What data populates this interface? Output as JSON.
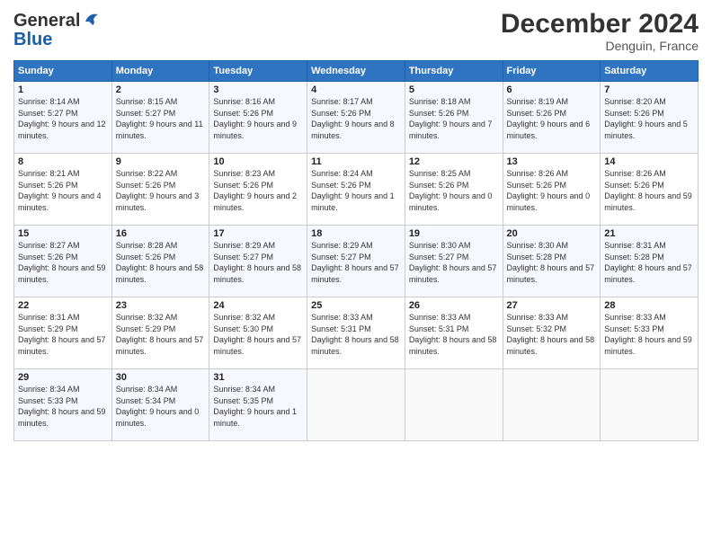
{
  "header": {
    "logo_general": "General",
    "logo_blue": "Blue",
    "month": "December 2024",
    "location": "Denguin, France"
  },
  "days_of_week": [
    "Sunday",
    "Monday",
    "Tuesday",
    "Wednesday",
    "Thursday",
    "Friday",
    "Saturday"
  ],
  "weeks": [
    [
      {
        "day": "1",
        "sunrise": "Sunrise: 8:14 AM",
        "sunset": "Sunset: 5:27 PM",
        "daylight": "Daylight: 9 hours and 12 minutes."
      },
      {
        "day": "2",
        "sunrise": "Sunrise: 8:15 AM",
        "sunset": "Sunset: 5:27 PM",
        "daylight": "Daylight: 9 hours and 11 minutes."
      },
      {
        "day": "3",
        "sunrise": "Sunrise: 8:16 AM",
        "sunset": "Sunset: 5:26 PM",
        "daylight": "Daylight: 9 hours and 9 minutes."
      },
      {
        "day": "4",
        "sunrise": "Sunrise: 8:17 AM",
        "sunset": "Sunset: 5:26 PM",
        "daylight": "Daylight: 9 hours and 8 minutes."
      },
      {
        "day": "5",
        "sunrise": "Sunrise: 8:18 AM",
        "sunset": "Sunset: 5:26 PM",
        "daylight": "Daylight: 9 hours and 7 minutes."
      },
      {
        "day": "6",
        "sunrise": "Sunrise: 8:19 AM",
        "sunset": "Sunset: 5:26 PM",
        "daylight": "Daylight: 9 hours and 6 minutes."
      },
      {
        "day": "7",
        "sunrise": "Sunrise: 8:20 AM",
        "sunset": "Sunset: 5:26 PM",
        "daylight": "Daylight: 9 hours and 5 minutes."
      }
    ],
    [
      {
        "day": "8",
        "sunrise": "Sunrise: 8:21 AM",
        "sunset": "Sunset: 5:26 PM",
        "daylight": "Daylight: 9 hours and 4 minutes."
      },
      {
        "day": "9",
        "sunrise": "Sunrise: 8:22 AM",
        "sunset": "Sunset: 5:26 PM",
        "daylight": "Daylight: 9 hours and 3 minutes."
      },
      {
        "day": "10",
        "sunrise": "Sunrise: 8:23 AM",
        "sunset": "Sunset: 5:26 PM",
        "daylight": "Daylight: 9 hours and 2 minutes."
      },
      {
        "day": "11",
        "sunrise": "Sunrise: 8:24 AM",
        "sunset": "Sunset: 5:26 PM",
        "daylight": "Daylight: 9 hours and 1 minute."
      },
      {
        "day": "12",
        "sunrise": "Sunrise: 8:25 AM",
        "sunset": "Sunset: 5:26 PM",
        "daylight": "Daylight: 9 hours and 0 minutes."
      },
      {
        "day": "13",
        "sunrise": "Sunrise: 8:26 AM",
        "sunset": "Sunset: 5:26 PM",
        "daylight": "Daylight: 9 hours and 0 minutes."
      },
      {
        "day": "14",
        "sunrise": "Sunrise: 8:26 AM",
        "sunset": "Sunset: 5:26 PM",
        "daylight": "Daylight: 8 hours and 59 minutes."
      }
    ],
    [
      {
        "day": "15",
        "sunrise": "Sunrise: 8:27 AM",
        "sunset": "Sunset: 5:26 PM",
        "daylight": "Daylight: 8 hours and 59 minutes."
      },
      {
        "day": "16",
        "sunrise": "Sunrise: 8:28 AM",
        "sunset": "Sunset: 5:26 PM",
        "daylight": "Daylight: 8 hours and 58 minutes."
      },
      {
        "day": "17",
        "sunrise": "Sunrise: 8:29 AM",
        "sunset": "Sunset: 5:27 PM",
        "daylight": "Daylight: 8 hours and 58 minutes."
      },
      {
        "day": "18",
        "sunrise": "Sunrise: 8:29 AM",
        "sunset": "Sunset: 5:27 PM",
        "daylight": "Daylight: 8 hours and 57 minutes."
      },
      {
        "day": "19",
        "sunrise": "Sunrise: 8:30 AM",
        "sunset": "Sunset: 5:27 PM",
        "daylight": "Daylight: 8 hours and 57 minutes."
      },
      {
        "day": "20",
        "sunrise": "Sunrise: 8:30 AM",
        "sunset": "Sunset: 5:28 PM",
        "daylight": "Daylight: 8 hours and 57 minutes."
      },
      {
        "day": "21",
        "sunrise": "Sunrise: 8:31 AM",
        "sunset": "Sunset: 5:28 PM",
        "daylight": "Daylight: 8 hours and 57 minutes."
      }
    ],
    [
      {
        "day": "22",
        "sunrise": "Sunrise: 8:31 AM",
        "sunset": "Sunset: 5:29 PM",
        "daylight": "Daylight: 8 hours and 57 minutes."
      },
      {
        "day": "23",
        "sunrise": "Sunrise: 8:32 AM",
        "sunset": "Sunset: 5:29 PM",
        "daylight": "Daylight: 8 hours and 57 minutes."
      },
      {
        "day": "24",
        "sunrise": "Sunrise: 8:32 AM",
        "sunset": "Sunset: 5:30 PM",
        "daylight": "Daylight: 8 hours and 57 minutes."
      },
      {
        "day": "25",
        "sunrise": "Sunrise: 8:33 AM",
        "sunset": "Sunset: 5:31 PM",
        "daylight": "Daylight: 8 hours and 58 minutes."
      },
      {
        "day": "26",
        "sunrise": "Sunrise: 8:33 AM",
        "sunset": "Sunset: 5:31 PM",
        "daylight": "Daylight: 8 hours and 58 minutes."
      },
      {
        "day": "27",
        "sunrise": "Sunrise: 8:33 AM",
        "sunset": "Sunset: 5:32 PM",
        "daylight": "Daylight: 8 hours and 58 minutes."
      },
      {
        "day": "28",
        "sunrise": "Sunrise: 8:33 AM",
        "sunset": "Sunset: 5:33 PM",
        "daylight": "Daylight: 8 hours and 59 minutes."
      }
    ],
    [
      {
        "day": "29",
        "sunrise": "Sunrise: 8:34 AM",
        "sunset": "Sunset: 5:33 PM",
        "daylight": "Daylight: 8 hours and 59 minutes."
      },
      {
        "day": "30",
        "sunrise": "Sunrise: 8:34 AM",
        "sunset": "Sunset: 5:34 PM",
        "daylight": "Daylight: 9 hours and 0 minutes."
      },
      {
        "day": "31",
        "sunrise": "Sunrise: 8:34 AM",
        "sunset": "Sunset: 5:35 PM",
        "daylight": "Daylight: 9 hours and 1 minute."
      },
      null,
      null,
      null,
      null
    ]
  ]
}
